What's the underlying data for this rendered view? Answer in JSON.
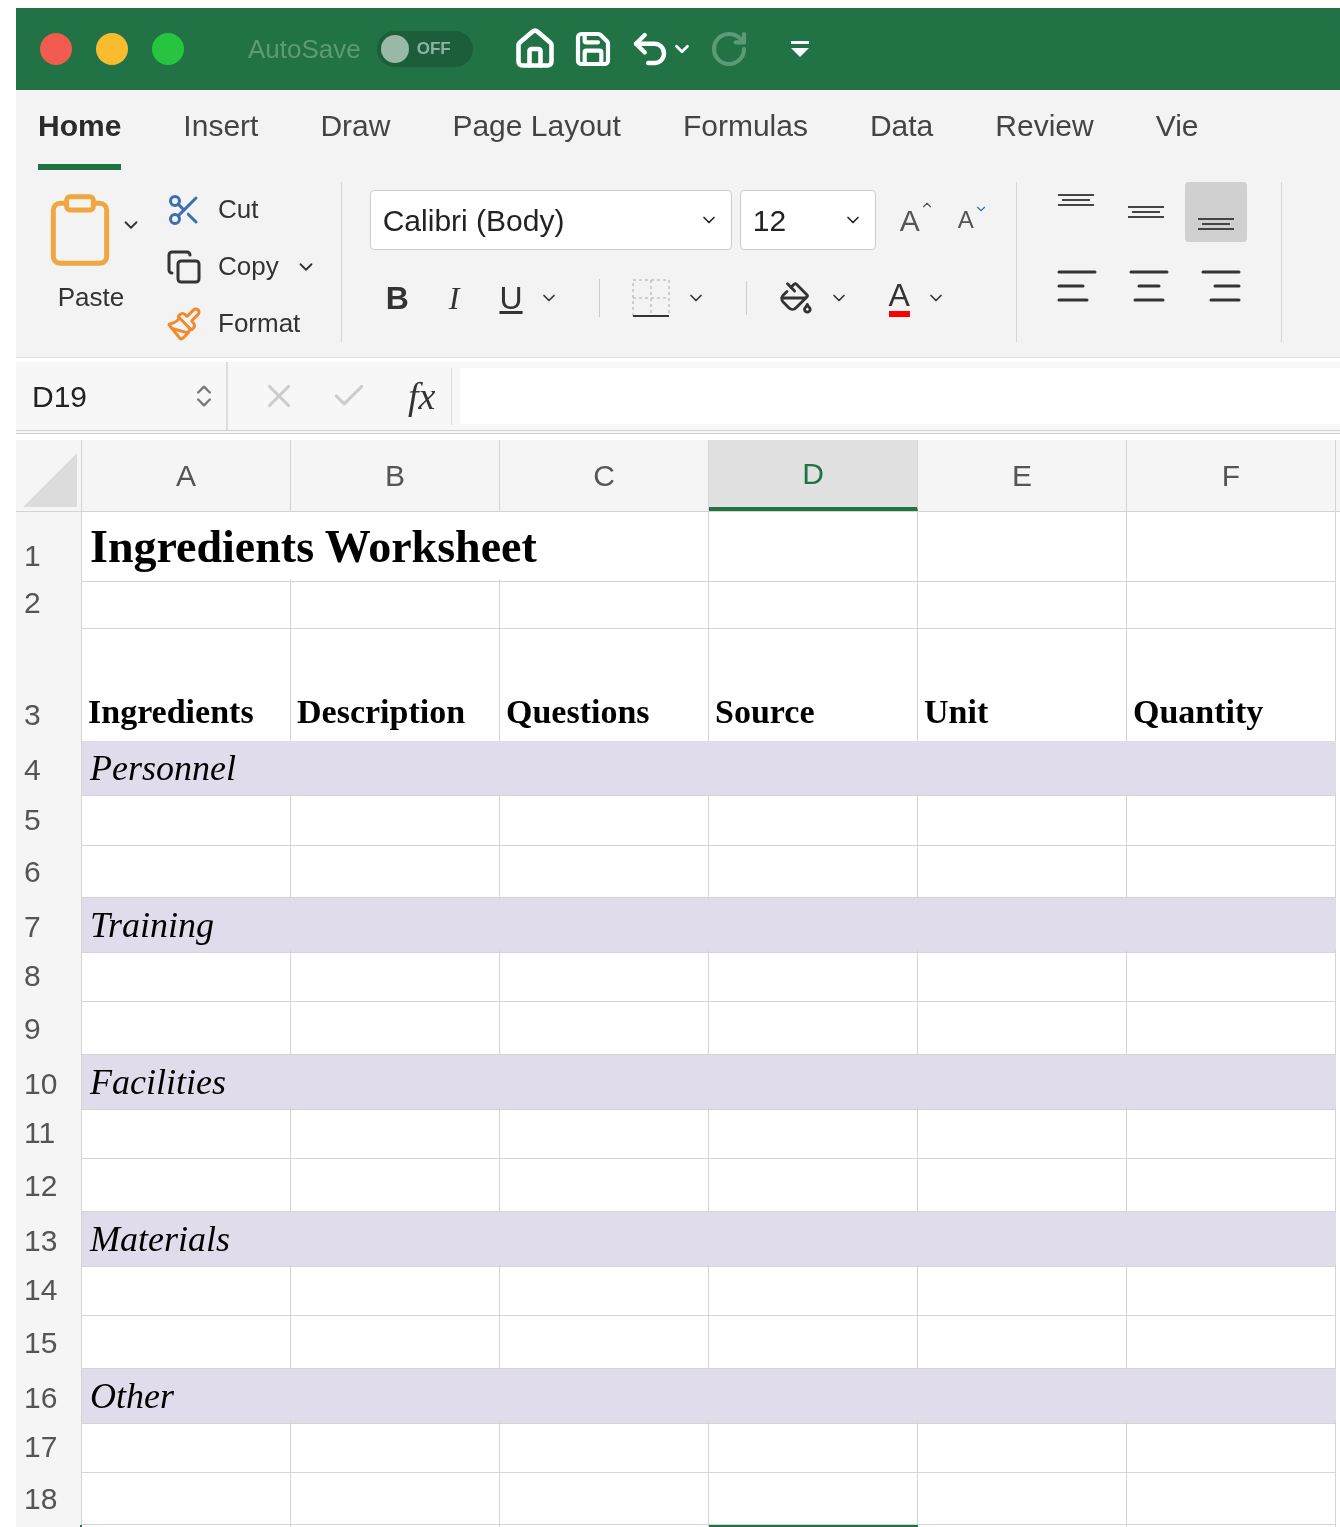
{
  "autosave": {
    "label": "AutoSave",
    "on": false,
    "state_label": "OFF"
  },
  "ribbon_tabs": [
    {
      "label": "Home",
      "selected": true
    },
    {
      "label": "Insert",
      "selected": false
    },
    {
      "label": "Draw",
      "selected": false
    },
    {
      "label": "Page Layout",
      "selected": false
    },
    {
      "label": "Formulas",
      "selected": false
    },
    {
      "label": "Data",
      "selected": false
    },
    {
      "label": "Review",
      "selected": false
    },
    {
      "label": "Vie",
      "selected": false
    }
  ],
  "clipboard": {
    "paste": "Paste",
    "cut": "Cut",
    "copy": "Copy",
    "format": "Format"
  },
  "font": {
    "name": "Calibri (Body)",
    "size": "12",
    "grow": "A",
    "shrink": "A",
    "bold": "B",
    "italic": "I",
    "underline": "U",
    "font_color": "A"
  },
  "vertical_alignment": [
    {
      "selected": false
    },
    {
      "selected": false
    },
    {
      "selected": true
    }
  ],
  "formula_bar": {
    "name_box": "D19",
    "fx": "fx"
  },
  "sheet": {
    "columns": [
      {
        "label": "A",
        "selected": false
      },
      {
        "label": "B",
        "selected": false
      },
      {
        "label": "C",
        "selected": false
      },
      {
        "label": "D",
        "selected": true
      },
      {
        "label": "E",
        "selected": false
      },
      {
        "label": "F",
        "selected": false
      }
    ],
    "rows": [
      {
        "number": "1",
        "kind": "title",
        "text": "Ingredients Worksheet"
      },
      {
        "number": "2",
        "kind": "blank"
      },
      {
        "number": "3",
        "kind": "headers",
        "cells": [
          "Ingredients",
          "Description",
          "Questions",
          "Source",
          "Unit",
          "Quantity"
        ]
      },
      {
        "number": "4",
        "kind": "section",
        "text": "Personnel"
      },
      {
        "number": "5",
        "kind": "blank"
      },
      {
        "number": "6",
        "kind": "blank"
      },
      {
        "number": "7",
        "kind": "section",
        "text": "Training"
      },
      {
        "number": "8",
        "kind": "blank"
      },
      {
        "number": "9",
        "kind": "blank"
      },
      {
        "number": "10",
        "kind": "section",
        "text": "Facilities"
      },
      {
        "number": "11",
        "kind": "blank"
      },
      {
        "number": "12",
        "kind": "blank"
      },
      {
        "number": "13",
        "kind": "section",
        "text": "Materials"
      },
      {
        "number": "14",
        "kind": "blank"
      },
      {
        "number": "15",
        "kind": "blank"
      },
      {
        "number": "16",
        "kind": "section",
        "text": "Other"
      },
      {
        "number": "17",
        "kind": "blank"
      },
      {
        "number": "18",
        "kind": "blank"
      }
    ]
  }
}
